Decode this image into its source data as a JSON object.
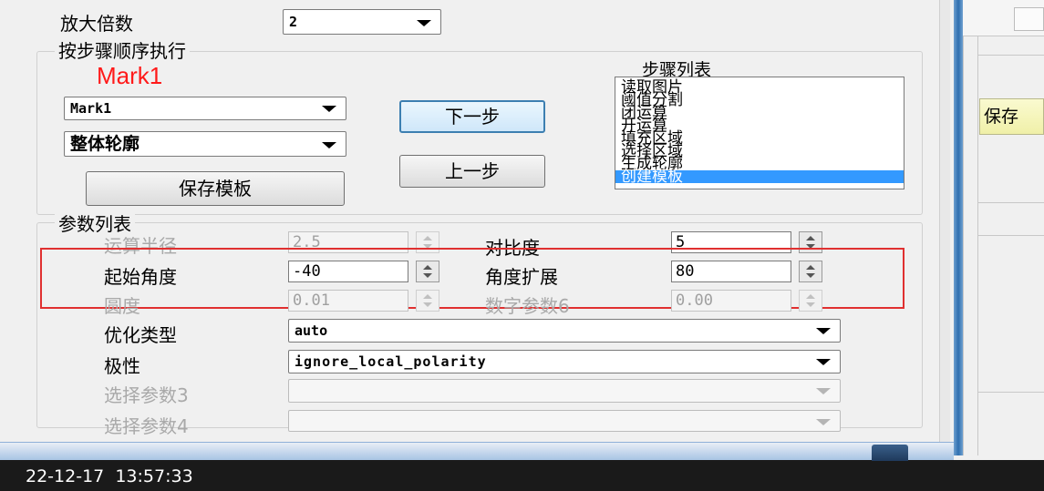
{
  "magnification": {
    "label": "放大倍数",
    "value": "2"
  },
  "step_group": {
    "legend": "按步骤顺序执行",
    "mark_title": "Mark1",
    "mark_title_color": "#ff1a1a",
    "mark_combo": "Mark1",
    "contour_combo": "整体轮廓",
    "save_template": "保存模板",
    "next_step": "下一步",
    "prev_step": "上一步",
    "step_list_label": "步骤列表",
    "steps": [
      "读取图片",
      "阈值分割",
      "闭运算",
      "开运算",
      "填充区域",
      "选择区域",
      "生成轮廓",
      "创建模板"
    ],
    "selected_step": "创建模板"
  },
  "params": {
    "legend": "参数列表",
    "op_radius": {
      "label": "运算半径",
      "value": "2.5"
    },
    "contrast": {
      "label": "对比度",
      "value": "5"
    },
    "start_angle": {
      "label": "起始角度",
      "value": "-40"
    },
    "angle_extent": {
      "label": "角度扩展",
      "value": "80"
    },
    "roundness": {
      "label": "圆度",
      "value": "0.01"
    },
    "num_param6": {
      "label": "数字参数6",
      "value": "0.00"
    },
    "optimization": {
      "label": "优化类型",
      "value": "auto"
    },
    "polarity": {
      "label": "极性",
      "value": "ignore_local_polarity"
    },
    "select_param3": {
      "label": "选择参数3",
      "value": ""
    },
    "select_param4": {
      "label": "选择参数4",
      "value": ""
    }
  },
  "right_panel": {
    "partial_button": "保存"
  },
  "status_bar": {
    "timestamp": "22-12-17  13:57:33"
  },
  "colors": {
    "highlight_box": "#e03030",
    "selection": "#3399ff",
    "taskbar": "#1a1a1a"
  }
}
